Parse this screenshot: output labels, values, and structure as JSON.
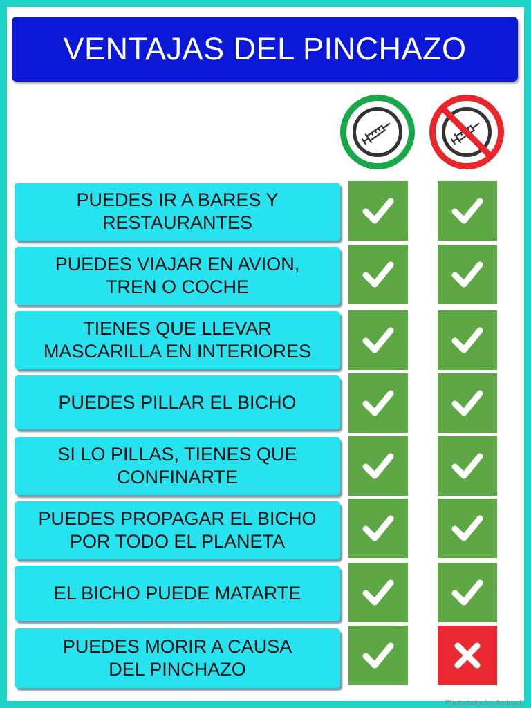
{
  "title": "VENTAJAS DEL PINCHAZO",
  "columns": [
    {
      "name": "vaccinated-column",
      "icon": "syringe-icon"
    },
    {
      "name": "unvaccinated-column",
      "icon": "no-syringe-icon"
    }
  ],
  "rows": [
    {
      "label": "PUEDES IR A BARES Y\nRESTAURANTES",
      "vaccinated": "check",
      "unvaccinated": "check"
    },
    {
      "label": "PUEDES VIAJAR EN AVION,\nTREN O COCHE",
      "vaccinated": "check",
      "unvaccinated": "check"
    },
    {
      "label": "TIENES QUE LLEVAR\nMASCARILLA EN INTERIORES",
      "vaccinated": "check",
      "unvaccinated": "check"
    },
    {
      "label": "PUEDES PILLAR EL BICHO",
      "vaccinated": "check",
      "unvaccinated": "check"
    },
    {
      "label": "SI LO PILLAS, TIENES QUE\nCONFINARTE",
      "vaccinated": "check",
      "unvaccinated": "check"
    },
    {
      "label": "PUEDES PROPAGAR EL BICHO\nPOR TODO EL PLANETA",
      "vaccinated": "check",
      "unvaccinated": "check"
    },
    {
      "label": "EL BICHO PUEDE MATARTE",
      "vaccinated": "check",
      "unvaccinated": "check"
    },
    {
      "label": "PUEDES MORIR A CAUSA\nDEL PINCHAZO",
      "vaccinated": "check",
      "unvaccinated": "cross"
    }
  ],
  "watermark": "Photo talks for Android",
  "colors": {
    "title_bg": "#0b18d6",
    "label_bg": "#27e3f0",
    "check_bg": "#5da844",
    "cross_bg": "#ea2a30",
    "frame": "#1fd3c8"
  }
}
